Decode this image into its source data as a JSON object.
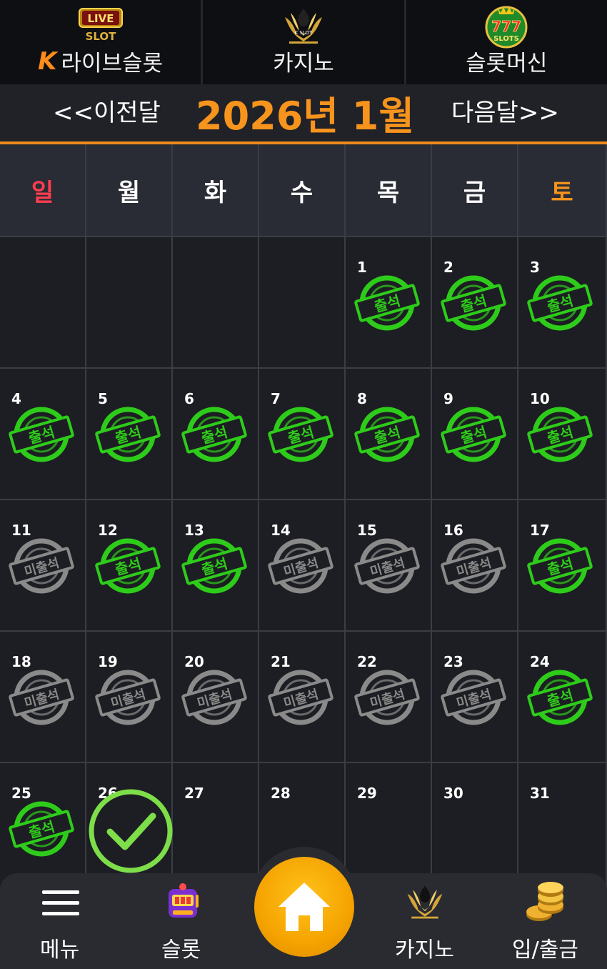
{
  "top_nav": [
    {
      "id": "live-slot",
      "icon": "live-slot-logo-icon",
      "badge": "LIVE",
      "badge_sub": "SLOT",
      "label": "라이브슬롯",
      "prefix": "K"
    },
    {
      "id": "casino",
      "icon": "k-slot-casino-logo-icon",
      "badge": "K SLOT",
      "label": "카지노"
    },
    {
      "id": "slot-machine",
      "icon": "777-slots-logo-icon",
      "badge": "777",
      "badge_sub": "SLOTS",
      "label": "슬롯머신"
    }
  ],
  "month_header": {
    "prev_label": "<<이전달",
    "title": "2026년 1월",
    "next_label": "다음달>>"
  },
  "weekdays": [
    "일",
    "월",
    "화",
    "수",
    "목",
    "금",
    "토"
  ],
  "stamps": {
    "attended": "출석",
    "absent": "미출석"
  },
  "colors": {
    "accent": "#f7941d",
    "sunday": "#ff3d4e",
    "attended_green": "#2ecc1a",
    "absent_gray": "#8a8a8a"
  },
  "weeks": [
    [
      null,
      null,
      null,
      null,
      {
        "day": "1",
        "status": "attended"
      },
      {
        "day": "2",
        "status": "attended"
      },
      {
        "day": "3",
        "status": "attended"
      }
    ],
    [
      {
        "day": "4",
        "status": "attended"
      },
      {
        "day": "5",
        "status": "attended"
      },
      {
        "day": "6",
        "status": "attended"
      },
      {
        "day": "7",
        "status": "attended"
      },
      {
        "day": "8",
        "status": "attended"
      },
      {
        "day": "9",
        "status": "attended"
      },
      {
        "day": "10",
        "status": "attended"
      }
    ],
    [
      {
        "day": "11",
        "status": "absent"
      },
      {
        "day": "12",
        "status": "attended"
      },
      {
        "day": "13",
        "status": "attended"
      },
      {
        "day": "14",
        "status": "absent"
      },
      {
        "day": "15",
        "status": "absent"
      },
      {
        "day": "16",
        "status": "absent"
      },
      {
        "day": "17",
        "status": "attended"
      }
    ],
    [
      {
        "day": "18",
        "status": "absent"
      },
      {
        "day": "19",
        "status": "absent"
      },
      {
        "day": "20",
        "status": "absent"
      },
      {
        "day": "21",
        "status": "absent"
      },
      {
        "day": "22",
        "status": "absent"
      },
      {
        "day": "23",
        "status": "absent"
      },
      {
        "day": "24",
        "status": "attended"
      }
    ],
    [
      {
        "day": "25",
        "status": "attended"
      },
      {
        "day": "26",
        "status": "today"
      },
      {
        "day": "27",
        "status": "none"
      },
      {
        "day": "28",
        "status": "none"
      },
      {
        "day": "29",
        "status": "none"
      },
      {
        "day": "30",
        "status": "none"
      },
      {
        "day": "31",
        "status": "none"
      }
    ]
  ],
  "today_check_icon": "green-checkmark-icon",
  "bottom_nav": {
    "menu": {
      "label": "메뉴",
      "icon": "hamburger-icon"
    },
    "slot": {
      "label": "슬롯",
      "icon": "slot-machine-icon"
    },
    "home": {
      "icon": "home-icon"
    },
    "casino": {
      "label": "카지노",
      "icon": "k-slot-casino-logo-icon"
    },
    "cash": {
      "label": "입/출금",
      "icon": "gold-coins-icon"
    }
  }
}
